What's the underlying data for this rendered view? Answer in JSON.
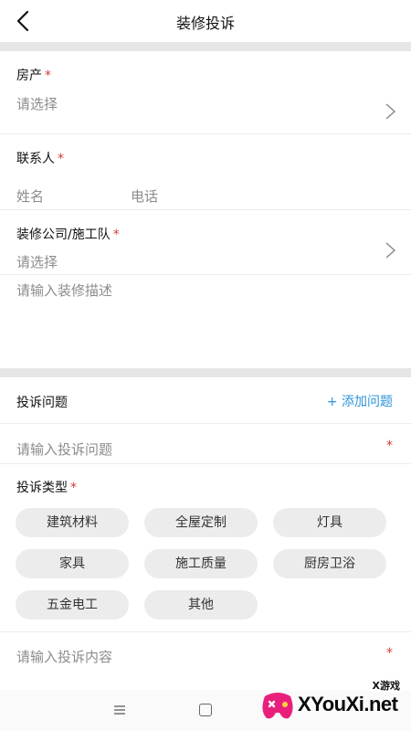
{
  "header": {
    "title": "装修投诉"
  },
  "property": {
    "label": "房产",
    "required": "*",
    "placeholder": "请选择"
  },
  "contact": {
    "label": "联系人",
    "required": "*",
    "name_placeholder": "姓名",
    "phone_placeholder": "电话"
  },
  "company": {
    "label": "装修公司/施工队",
    "required": "*",
    "placeholder": "请选择"
  },
  "description": {
    "placeholder": "请输入装修描述"
  },
  "complaint_problem": {
    "label": "投诉问题",
    "add_label": "+ 添加问题",
    "input_placeholder": "请输入投诉问题",
    "required": "*"
  },
  "complaint_type": {
    "label": "投诉类型",
    "required": "*",
    "options": [
      "建筑材料",
      "全屋定制",
      "灯具",
      "家具",
      "施工质量",
      "厨房卫浴",
      "五金电工",
      "其他"
    ]
  },
  "complaint_content": {
    "placeholder": "请输入投诉内容",
    "required": "*"
  },
  "watermark": {
    "badge": "X游戏",
    "text": "XYouXi.net"
  },
  "colors": {
    "accent": "#2f93d8",
    "required": "#d23b3b",
    "chip_bg": "#ececec",
    "band": "#e6e6e6"
  },
  "icons": [
    "back-arrow-icon",
    "chevron-right-icon",
    "menu-icon",
    "home-square-icon"
  ]
}
